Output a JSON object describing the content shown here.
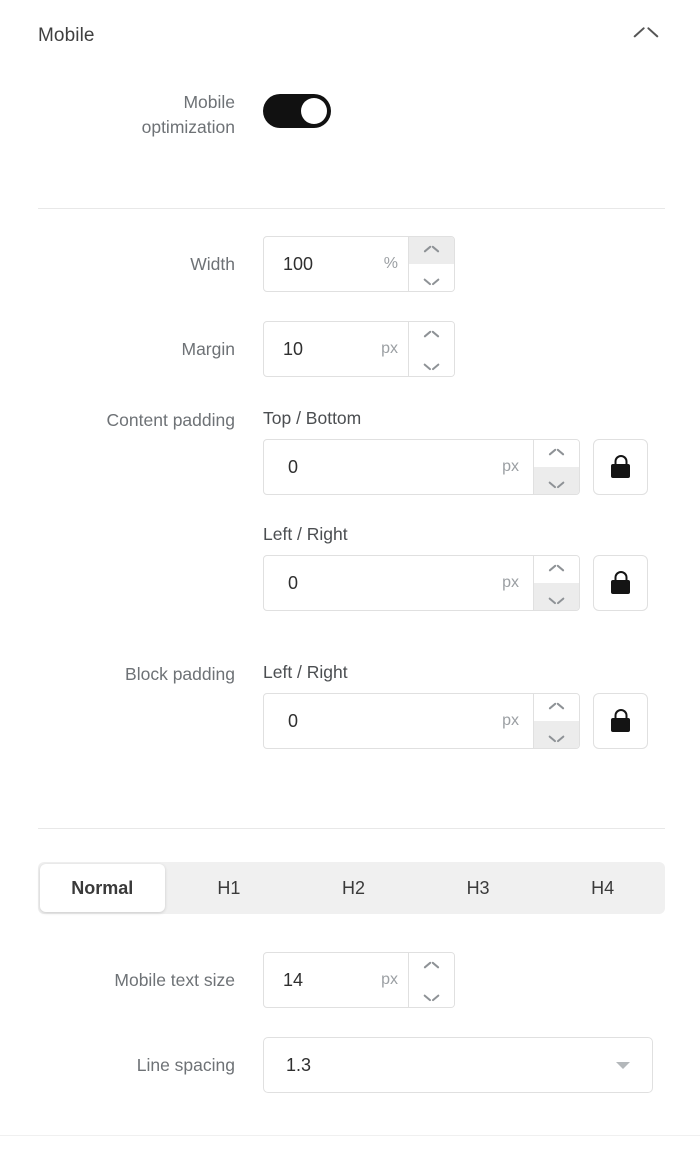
{
  "panel": {
    "title": "Mobile",
    "collapse_icon": "chevron-up-icon"
  },
  "mobile_optimization": {
    "label_line1": "Mobile",
    "label_line2": "optimization",
    "state": "on",
    "accent_color": "#111111"
  },
  "width": {
    "label": "Width",
    "value": "100",
    "unit": "%"
  },
  "margin": {
    "label": "Margin",
    "value": "10",
    "unit": "px"
  },
  "content_padding": {
    "label": "Content padding",
    "top_bottom": {
      "sub_label": "Top / Bottom",
      "value": "0",
      "unit": "px",
      "lock_icon": "lock-closed-icon"
    },
    "left_right": {
      "sub_label": "Left / Right",
      "value": "0",
      "unit": "px",
      "lock_icon": "lock-closed-icon"
    }
  },
  "block_padding": {
    "label": "Block padding",
    "left_right": {
      "sub_label": "Left / Right",
      "value": "0",
      "unit": "px",
      "lock_icon": "lock-closed-icon"
    }
  },
  "text_style_tabs": {
    "items": [
      {
        "label": "Normal",
        "active": true
      },
      {
        "label": "H1",
        "active": false
      },
      {
        "label": "H2",
        "active": false
      },
      {
        "label": "H3",
        "active": false
      },
      {
        "label": "H4",
        "active": false
      }
    ]
  },
  "mobile_text_size": {
    "label": "Mobile text size",
    "value": "14",
    "unit": "px"
  },
  "line_spacing": {
    "label": "Line spacing",
    "value": "1.3",
    "caret_icon": "caret-down-icon"
  },
  "colors": {
    "background": "#ffffff",
    "label_text": "#6e7276",
    "value_text": "#2f2f2f",
    "border": "#e0e0e0",
    "divider": "#e8e8e8",
    "tab_track": "#f0f0f0",
    "toggle_on": "#111111"
  }
}
